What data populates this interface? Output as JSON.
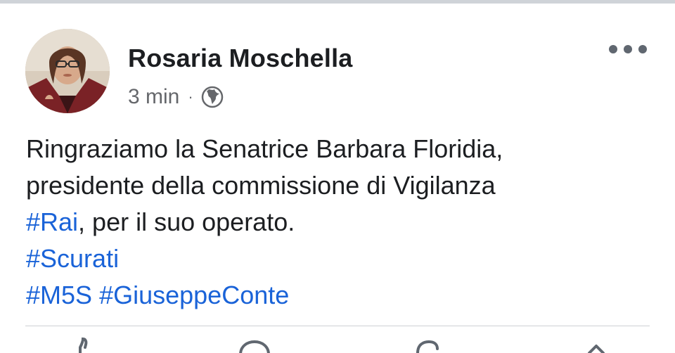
{
  "post": {
    "author": "Rosaria Moschella",
    "time": "3 min",
    "separator": "·",
    "privacy_icon": "globe-icon",
    "more_icon": "more-horizontal-icon",
    "body": {
      "line1": "Ringraziamo la Senatrice Barbara Floridia,",
      "line2": "presidente della commissione di Vigilanza",
      "line3_tag": "#Rai",
      "line3_text": ", per il suo operato.",
      "tag_scurati": "#Scurati",
      "tag_m5s": "#M5S",
      "tag_conte": "#GiuseppeConte"
    }
  },
  "actions": [
    {
      "icon": "like-icon"
    },
    {
      "icon": "comment-icon"
    },
    {
      "icon": "reaction-icon"
    },
    {
      "icon": "share-icon"
    }
  ],
  "colors": {
    "hashtag": "#1a63d8",
    "text": "#1c1e21",
    "meta": "#65676b"
  }
}
